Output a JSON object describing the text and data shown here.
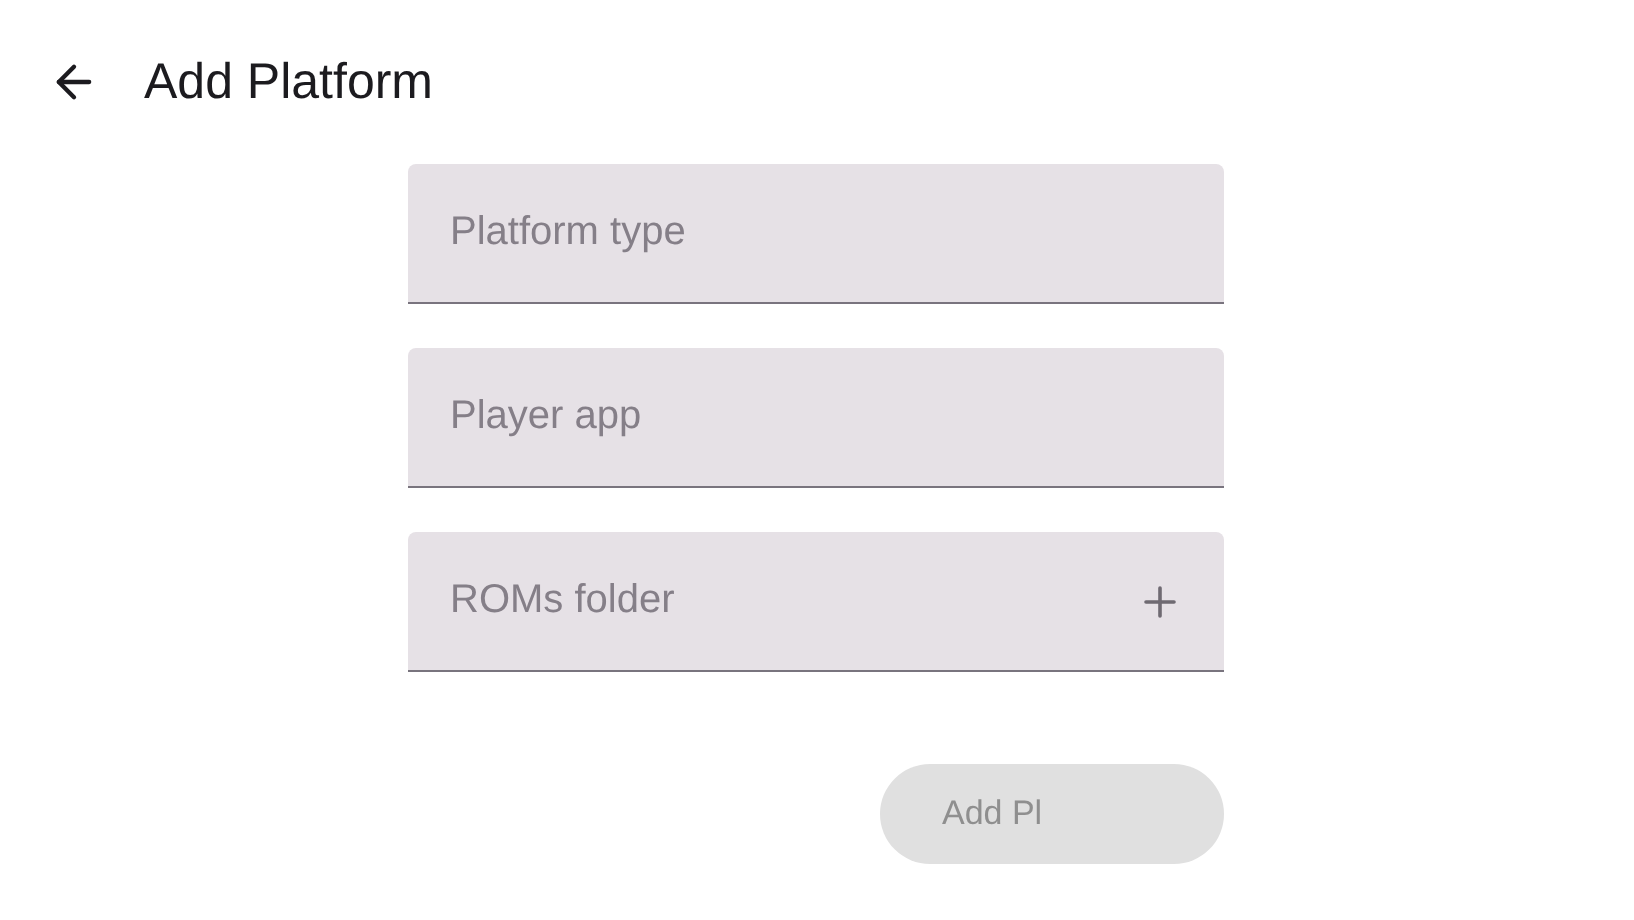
{
  "header": {
    "title": "Add Platform"
  },
  "fields": [
    {
      "placeholder": "Platform type",
      "kind": "text"
    },
    {
      "placeholder": "Player app",
      "kind": "text"
    },
    {
      "placeholder": "ROMs folder",
      "kind": "folder"
    }
  ],
  "submit": {
    "label": "Add Pl",
    "disabled": true
  }
}
